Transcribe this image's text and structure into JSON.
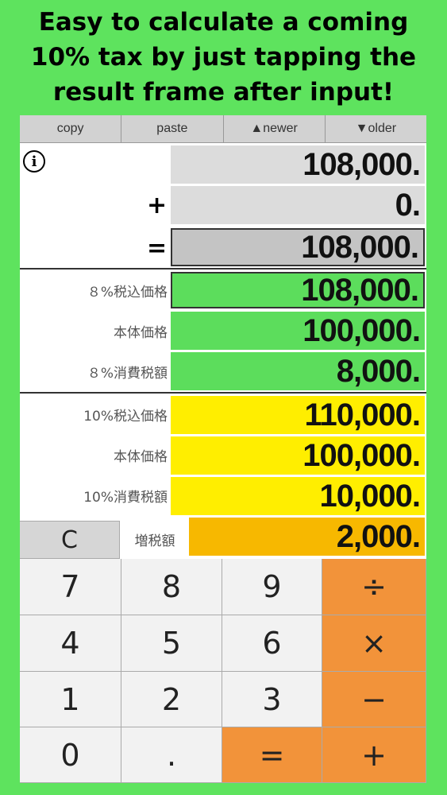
{
  "headline": {
    "line1": "Easy to calculate a coming",
    "line2": "10% tax by just tapping the",
    "line3": "result frame after input!"
  },
  "toolbar": {
    "copy": "copy",
    "paste": "paste",
    "newer": "▲newer",
    "older": "▼older"
  },
  "calc": {
    "input1": "108,000.",
    "plus_op": "+",
    "input2": "0.",
    "equals_op": "=",
    "result": "108,000."
  },
  "tax8": {
    "incl_label": "８%税込価格",
    "incl_value": "108,000.",
    "base_label": "本体価格",
    "base_value": "100,000.",
    "tax_label": "８%消費税額",
    "tax_value": "8,000."
  },
  "tax10": {
    "incl_label": "10%税込価格",
    "incl_value": "110,000.",
    "base_label": "本体価格",
    "base_value": "100,000.",
    "tax_label": "10%消費税額",
    "tax_value": "10,000."
  },
  "increase": {
    "clear_label": "C",
    "label": "増税額",
    "value": "2,000."
  },
  "keys": {
    "k7": "7",
    "k8": "8",
    "k9": "9",
    "div": "÷",
    "k4": "4",
    "k5": "5",
    "k6": "6",
    "mul": "×",
    "k1": "1",
    "k2": "2",
    "k3": "3",
    "sub": "−",
    "k0": "0",
    "dot": ".",
    "eq": "=",
    "add": "+"
  },
  "colors": {
    "background": "#5ee35e",
    "green_field": "#5cdd5c",
    "yellow_field": "#ffee00",
    "orange_field": "#f7b800",
    "operator_key": "#f2933a",
    "grey_field": "#dcdcdc"
  }
}
